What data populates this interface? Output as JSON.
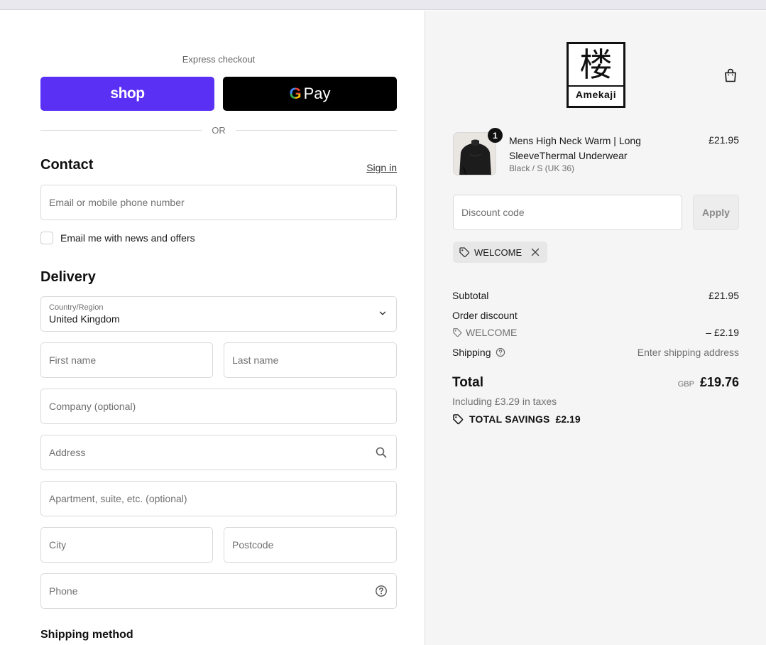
{
  "express": {
    "label": "Express checkout",
    "shop_label": "shop",
    "gpay_g": "G",
    "gpay_label": "Pay",
    "or_label": "OR"
  },
  "contact": {
    "heading": "Contact",
    "signin_label": "Sign in",
    "email_placeholder": "Email or mobile phone number",
    "newsletter_label": "Email me with news and offers"
  },
  "delivery": {
    "heading": "Delivery",
    "country_label": "Country/Region",
    "country_value": "United Kingdom",
    "first_name": "First name",
    "last_name": "Last name",
    "company": "Company (optional)",
    "address": "Address",
    "apartment": "Apartment, suite, etc. (optional)",
    "city": "City",
    "postcode": "Postcode",
    "phone": "Phone"
  },
  "shipping_method_heading": "Shipping method",
  "brand": {
    "kanji": "楼",
    "name": "Amekaji"
  },
  "cart": {
    "item": {
      "quantity": "1",
      "name": "Mens High Neck Warm | Long SleeveThermal Underwear",
      "variant": "Black / S (UK 36)",
      "price": "£21.95"
    },
    "discount_placeholder": "Discount code",
    "apply_label": "Apply",
    "applied_code": "WELCOME"
  },
  "summary": {
    "subtotal_label": "Subtotal",
    "subtotal_value": "£21.95",
    "order_discount_label": "Order discount",
    "discount_code": "WELCOME",
    "discount_value": "– £2.19",
    "shipping_label": "Shipping",
    "shipping_value": "Enter shipping address",
    "total_label": "Total",
    "currency": "GBP",
    "total_value": "£19.76",
    "taxes_note": "Including £3.29 in taxes",
    "savings_label": "TOTAL SAVINGS",
    "savings_value": "£2.19"
  },
  "colors": {
    "shop_pay": "#5a31f4",
    "gpay": "#000000",
    "summary_bg": "#f5f5f5"
  }
}
